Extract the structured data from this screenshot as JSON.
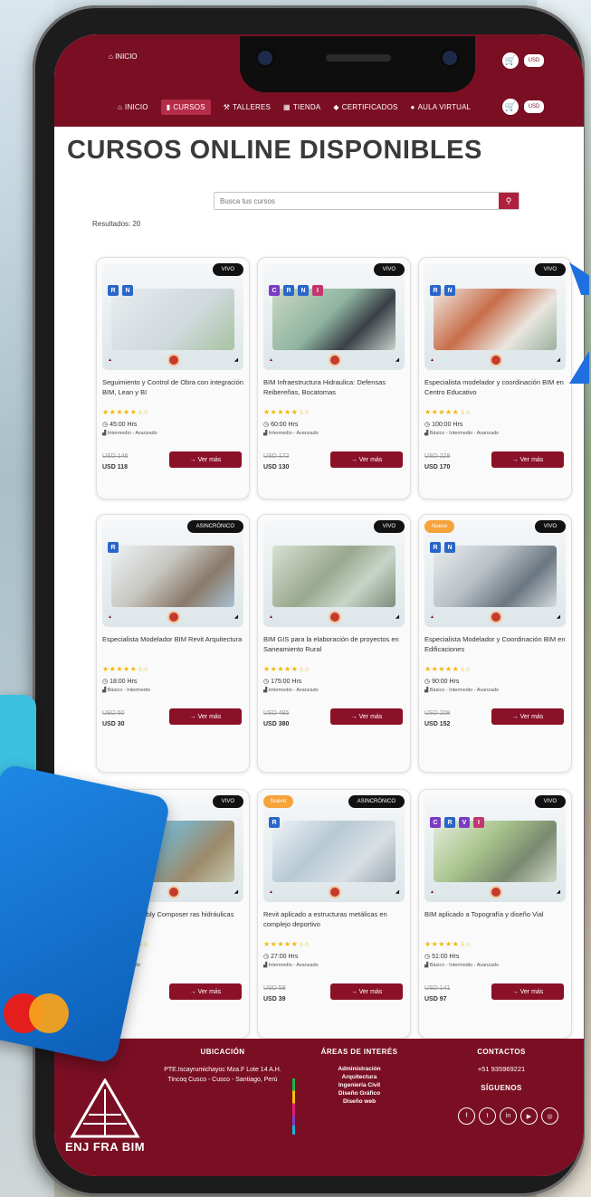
{
  "nav": {
    "top_items": [
      "INICIO"
    ],
    "items": [
      {
        "label": "INICIO",
        "icon": "home-icon"
      },
      {
        "label": "CURSOS",
        "icon": "book-icon",
        "active": true
      },
      {
        "label": "TALLERES",
        "icon": "tools-icon"
      },
      {
        "label": "TIENDA",
        "icon": "store-icon"
      },
      {
        "label": "CERTIFICADOS",
        "icon": "graduation-cap-icon"
      },
      {
        "label": "AULA VIRTUAL",
        "icon": "user-icon"
      }
    ],
    "currency": "USD"
  },
  "page": {
    "title": "CURSOS ONLINE DISPONIBLES",
    "search_placeholder": "Busca tus cursos",
    "results": "Resultados: 20"
  },
  "colors": {
    "brand": "#7a0f24",
    "button": "#8a1127",
    "accent": "#f5a33a",
    "star": "#f2b705"
  },
  "courses": [
    {
      "badge": "VIVO",
      "nuevo": "",
      "title": "Seguimiento y Control de Obra con integración BIM, Lean y BI",
      "rating": "5.0",
      "hours": "45:00 Hrs",
      "level": "Intermedio - Avanzado",
      "old_price": "USD 146",
      "price": "USD 118",
      "button": "→ Ver más"
    },
    {
      "badge": "VIVO",
      "nuevo": "",
      "title": "BIM Infraestructura Hidraulica: Defensas Reibereñas, Bocatomas",
      "rating": "5.0",
      "hours": "60:00 Hrs",
      "level": "Intermedio - Avanzado",
      "old_price": "USD 172",
      "price": "USD 130",
      "button": "→ Ver más"
    },
    {
      "badge": "VIVO",
      "nuevo": "",
      "title": "Especialista modelador y coordinación BIM en Centro Educativo",
      "rating": "5.0",
      "hours": "100:00 Hrs",
      "level": "Básico - Intermedio - Avanzado",
      "old_price": "USD 229",
      "price": "USD 170",
      "button": "→ Ver más"
    },
    {
      "badge": "ASINCRÓNICO",
      "nuevo": "",
      "title": "Especialista Modelador BIM Revit Arquitectura",
      "rating": "5.0",
      "hours": "18:00 Hrs",
      "level": "Básico - Intermedio",
      "old_price": "USD 50",
      "price": "USD 30",
      "button": "→ Ver más"
    },
    {
      "badge": "VIVO",
      "nuevo": "",
      "title": "BIM GIS para la elaboración de proyectos en Saneamiento Rural",
      "rating": "5.0",
      "hours": "175:00 Hrs",
      "level": "Intermedio - Avanzado",
      "old_price": "USD 485",
      "price": "USD 380",
      "button": "→ Ver más"
    },
    {
      "badge": "VIVO",
      "nuevo": "Nuevo",
      "title": "Especialista Modelador y Coordinación BIM en Edificaciones",
      "rating": "5.0",
      "hours": "90:00 Hrs",
      "level": "Básico - Intermedio - Avanzado",
      "old_price": "USD 208",
      "price": "USD 152",
      "button": "→ Ver más"
    },
    {
      "badge": "VIVO",
      "nuevo": "",
      "title": "D y Subassembly Composer ras hidráulicas",
      "rating": "5.0",
      "hours": "Hrs",
      "level": "dio - Avanzado",
      "old_price": "",
      "price": "",
      "button": "→ Ver más"
    },
    {
      "badge": "ASINCRÓNICO",
      "nuevo": "Nuevo",
      "title": "Revit aplicado a estructuras metálicas en complejo deportivo",
      "rating": "5.0",
      "hours": "27:00 Hrs",
      "level": "Intermedio - Avanzado",
      "old_price": "USD 59",
      "price": "USD 39",
      "button": "→ Ver más"
    },
    {
      "badge": "VIVO",
      "nuevo": "",
      "title": "BIM aplicado a Topografía y diseño Vial",
      "rating": "5.0",
      "hours": "51:00 Hrs",
      "level": "Básico - Intermedio - Avanzado",
      "old_price": "USD 141",
      "price": "USD 97",
      "button": "→ Ver más"
    }
  ],
  "footer": {
    "brand": "ENJ FRA BIM",
    "ubicacion_title": "UBICACIÓN",
    "ubicacion_text": "PTE.Iscayrumichayoc Mza.F Lote 14 A.H. Tincoq Cusco - Cusco - Santiago, Perú",
    "areas_title": "ÁREAS DE INTERÉS",
    "areas": [
      "Administración",
      "Arquitectura",
      "Ingeniería Civil",
      "Diseño Gráfico",
      "Diseño web"
    ],
    "contact_title": "CONTACTOS",
    "phone": "+51 935969221",
    "follow_title": "SÍGUENOS",
    "social": [
      "facebook-icon",
      "twitter-icon",
      "linkedin-icon",
      "youtube-icon",
      "instagram-icon"
    ]
  }
}
